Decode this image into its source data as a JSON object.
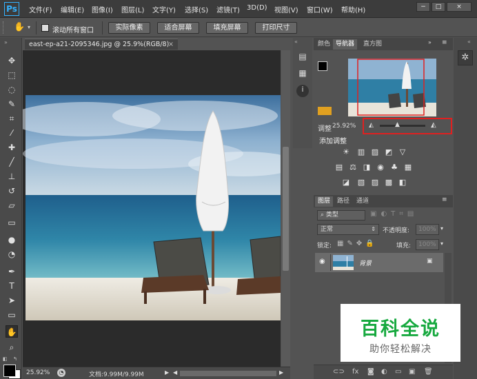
{
  "app": {
    "logo": "Ps",
    "menu": [
      "文件(F)",
      "编辑(E)",
      "图像(I)",
      "图层(L)",
      "文字(Y)",
      "选择(S)",
      "滤镜(T)",
      "3D(D)",
      "视图(V)",
      "窗口(W)",
      "帮助(H)"
    ],
    "window_controls": [
      "−",
      "□",
      "×"
    ]
  },
  "options_bar": {
    "scroll_all_label": "滚动所有窗口",
    "buttons": [
      "实际像素",
      "适合屏幕",
      "填充屏幕",
      "打印尺寸"
    ]
  },
  "document": {
    "tab_title": "east-ep-a21-2095346.jpg @ 25.9%(RGB/8)",
    "close": "×"
  },
  "status": {
    "zoom": "25.92%",
    "doc_info": "文档:9.99M/9.99M"
  },
  "navigator": {
    "tabs": [
      "颜色",
      "导航器",
      "直方图"
    ],
    "zoom_value": "25.92%"
  },
  "adjustments": {
    "partial_label": "调整",
    "title": "添加调整"
  },
  "layers": {
    "tabs": [
      "图层",
      "路径",
      "通道"
    ],
    "filter_kind": "类型",
    "blend_mode": "正常",
    "opacity_label": "不透明度:",
    "opacity_value": "100%",
    "lock_label": "锁定:",
    "fill_label": "填充:",
    "fill_value": "100%",
    "items": [
      {
        "name": "背景"
      }
    ]
  },
  "watermark": {
    "title": "百科全说",
    "subtitle": "助你轻松解决"
  },
  "colors": {
    "accent": "#34b2ff",
    "highlight": "#e02020",
    "watermark_green": "#17a93f"
  }
}
